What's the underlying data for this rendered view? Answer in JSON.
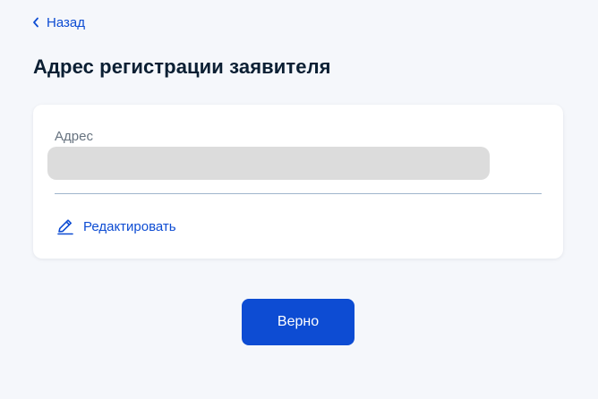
{
  "nav": {
    "back_label": "Назад"
  },
  "page": {
    "title": "Адрес регистрации заявителя"
  },
  "address_card": {
    "field_label": "Адрес",
    "field_value": "",
    "edit_label": "Редактировать"
  },
  "actions": {
    "confirm_label": "Верно"
  },
  "colors": {
    "accent": "#0d4cd3",
    "background": "#f5f7fb",
    "card": "#ffffff",
    "text": "#0b1f33",
    "muted_text": "#66727f",
    "redacted_placeholder": "#dcdcdc"
  },
  "icons": {
    "back": "chevron-left-icon",
    "edit": "pencil-icon"
  }
}
